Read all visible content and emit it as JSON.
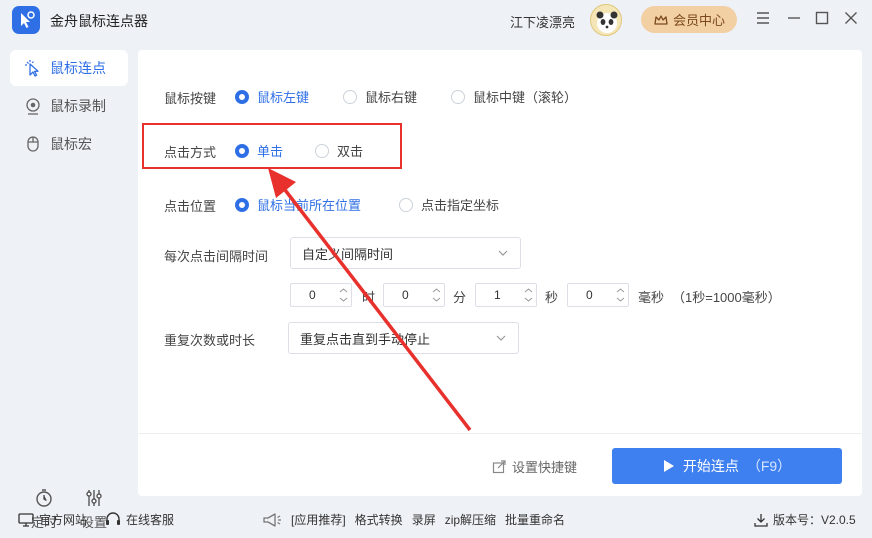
{
  "app": {
    "title": "金舟鼠标连点器",
    "username": "江下凌漂亮",
    "vip_label": "会员中心"
  },
  "sidebar": {
    "items": [
      {
        "label": "鼠标连点",
        "icon": "cursor-click-icon",
        "active": true
      },
      {
        "label": "鼠标录制",
        "icon": "record-icon",
        "active": false
      },
      {
        "label": "鼠标宏",
        "icon": "mouse-icon",
        "active": false
      }
    ],
    "bottom": [
      {
        "label": "定时",
        "icon": "timer-icon"
      },
      {
        "label": "设置",
        "icon": "settings-sliders-icon"
      }
    ]
  },
  "form": {
    "mouse_button": {
      "label": "鼠标按键",
      "options": [
        "鼠标左键",
        "鼠标右键",
        "鼠标中键（滚轮）"
      ],
      "selected": 0
    },
    "click_mode": {
      "label": "点击方式",
      "options": [
        "单击",
        "双击"
      ],
      "selected": 0
    },
    "click_position": {
      "label": "点击位置",
      "options": [
        "鼠标当前所在位置",
        "点击指定坐标"
      ],
      "selected": 0
    },
    "interval": {
      "label": "每次点击间隔时间",
      "select_value": "自定义间隔时间",
      "hours": "0",
      "hours_unit": "时",
      "minutes": "0",
      "minutes_unit": "分",
      "seconds": "1",
      "seconds_unit": "秒",
      "ms": "0",
      "ms_unit": "毫秒",
      "note": "（1秒=1000毫秒）"
    },
    "repeat": {
      "label": "重复次数或时长",
      "select_value": "重复点击直到手动停止"
    }
  },
  "footer": {
    "shortcut_label": "设置快捷键",
    "start_label": "开始连点",
    "start_hotkey": "（F9）"
  },
  "statusbar": {
    "website": "官方网站",
    "support": "在线客服",
    "recommend": "[应用推荐]",
    "apps": [
      "格式转换",
      "录屏",
      "zip解压缩",
      "批量重命名"
    ],
    "version": "版本号：V2.0.5"
  },
  "colors": {
    "accent": "#3f80f0",
    "annotation": "#e8312c",
    "vip": "#f3cfa4"
  }
}
